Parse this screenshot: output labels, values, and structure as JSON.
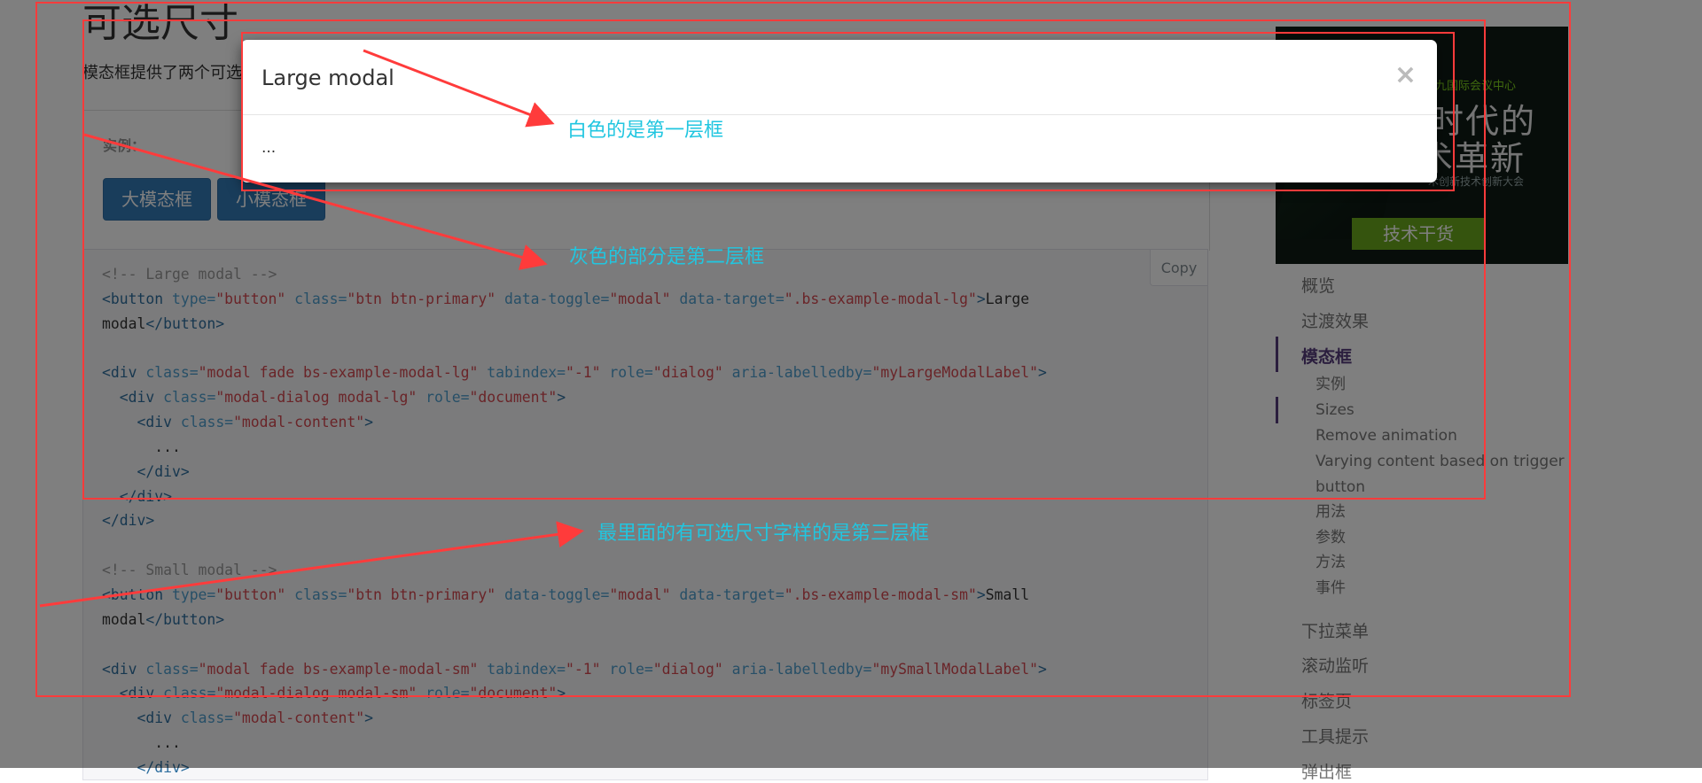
{
  "section": {
    "title": "可选尺寸",
    "description": "模态框提供了两个可选尺寸"
  },
  "example": {
    "label": "实例：",
    "large_button": "大模态框",
    "small_button": "小模态框"
  },
  "code": {
    "copy_label": "Copy"
  },
  "ad": {
    "line1": "九国际会议中心",
    "line2": "时代的",
    "line3": "术革新",
    "line4": "术创新技术创新大会",
    "tag": "技术干货"
  },
  "sidenav": {
    "items": [
      {
        "label": "概览"
      },
      {
        "label": "过渡效果"
      },
      {
        "label": "模态框"
      },
      {
        "label": "下拉菜单"
      },
      {
        "label": "滚动监听"
      },
      {
        "label": "标签页"
      },
      {
        "label": "工具提示"
      },
      {
        "label": "弹出框"
      }
    ],
    "subitems": [
      {
        "label": "实例"
      },
      {
        "label": "Sizes"
      },
      {
        "label": "Remove animation"
      },
      {
        "label": "Varying content based on trigger"
      },
      {
        "label": "button"
      },
      {
        "label": "用法"
      },
      {
        "label": "参数"
      },
      {
        "label": "方法"
      },
      {
        "label": "事件"
      }
    ]
  },
  "modal": {
    "title": "Large modal",
    "close_glyph": "×",
    "body": "..."
  },
  "annotations": {
    "layer1": "白色的是第一层框",
    "layer2": "灰色的部分是第二层框",
    "layer3": "最里面的有可选尺寸字样的是第三层框",
    "color": "#ff3b3b",
    "text_color": "#21c6e0"
  }
}
